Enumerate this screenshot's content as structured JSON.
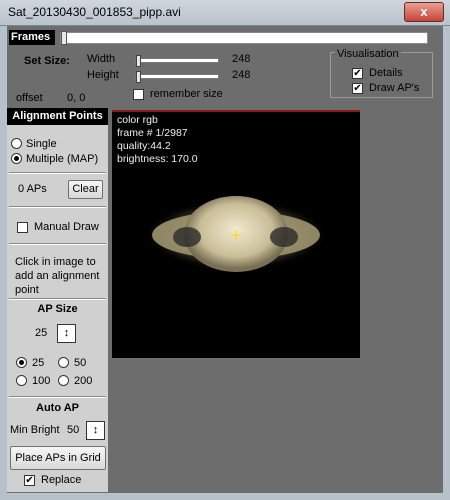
{
  "window": {
    "title": "Sat_20130430_001853_pipp.avi",
    "close_label": "x"
  },
  "frames": {
    "label": "Frames"
  },
  "set_size": {
    "label": "Set Size:",
    "width_label": "Width",
    "width_value": "248",
    "height_label": "Height",
    "height_value": "248",
    "remember_label": "remember size",
    "remember_checked": false
  },
  "offset": {
    "label": "offset",
    "value": "0, 0"
  },
  "visualisation": {
    "label": "Visualisation",
    "details_label": "Details",
    "details_checked": true,
    "draw_aps_label": "Draw AP's",
    "draw_aps_checked": true
  },
  "alignment": {
    "header": "Alignment Points",
    "single_label": "Single",
    "multiple_label": "Multiple (MAP)",
    "ap_count": "0 APs",
    "clear_label": "Clear",
    "manual_draw_label": "Manual Draw",
    "hint": "Click in image to add an alignment point"
  },
  "ap_size": {
    "header": "AP Size",
    "value": "25",
    "options": [
      "25",
      "50",
      "100",
      "200"
    ],
    "selected": "25"
  },
  "auto_ap": {
    "header": "Auto AP",
    "min_bright_label": "Min Bright",
    "min_bright_value": "50",
    "place_label": "Place APs in Grid",
    "replace_label": "Replace",
    "replace_checked": true
  },
  "image_info": {
    "color": "color rgb",
    "frame": "frame # 1/2987",
    "quality": "quality:44.2",
    "brightness": "brightness: 170.0"
  },
  "colors": {
    "crosshair": "#ffd800",
    "header_bg": "#000000",
    "panel_bg": "#d0d0d0"
  },
  "icons": {
    "spin": "spin-updown-icon",
    "check": "check-mark-icon"
  }
}
